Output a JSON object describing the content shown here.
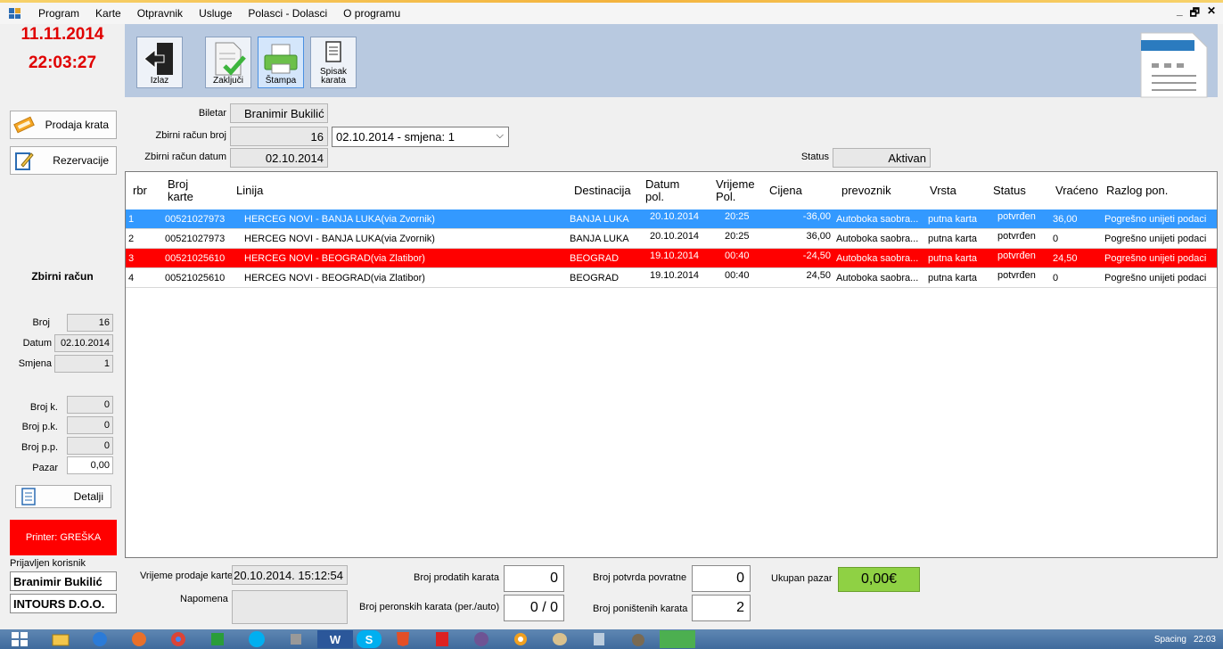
{
  "menu": {
    "items": [
      "Program",
      "Karte",
      "Otpravnik",
      "Usluge",
      "Polasci - Dolasci",
      "O programu"
    ],
    "win_min": "_",
    "win_restore": "🗗",
    "win_close": "✕"
  },
  "clock": {
    "date": "11.11.2014",
    "time": "22:03:27"
  },
  "sidebar": {
    "prodaja_label": "Prodaja krata",
    "rezervacije_label": "Rezervacije",
    "zbirni_title": "Zbirni račun",
    "broj_label": "Broj",
    "broj_value": "16",
    "datum_label": "Datum",
    "datum_value": "02.10.2014",
    "smjena_label": "Smjena",
    "smjena_value": "1",
    "brojk_label": "Broj k.",
    "brojk_value": "0",
    "brojpk_label": "Broj p.k.",
    "brojpk_value": "0",
    "brojpp_label": "Broj p.p.",
    "brojpp_value": "0",
    "pazar_label": "Pazar",
    "pazar_value": "0,00",
    "detalji_label": "Detalji",
    "printer_status": "Printer: GREŠKA",
    "prijavljen_label": "Prijavljen korisnik",
    "user_name": "Branimir Bukilić",
    "company": "INTOURS D.O.O."
  },
  "toolbar": {
    "izlaz": "Izlaz",
    "zakljuci": "Zaključi",
    "stampa": "Štampa",
    "spisak_1": "Spisak",
    "spisak_2": "karata"
  },
  "header": {
    "biletar_label": "Biletar",
    "biletar_value": "Branimir Bukilić",
    "racun_broj_label": "Zbirni račun broj",
    "racun_broj_value": "16",
    "smjena_select": "02.10.2014 - smjena: 1",
    "racun_datum_label": "Zbirni račun datum",
    "racun_datum_value": "02.10.2014",
    "status_label": "Status",
    "status_value": "Aktivan"
  },
  "grid": {
    "columns": {
      "rbr": "rbr",
      "broj_1": "Broj",
      "broj_2": "karte",
      "linija": "Linija",
      "destinacija": "Destinacija",
      "datum_1": "Datum",
      "datum_2": "pol.",
      "vrijeme_1": "Vrijeme",
      "vrijeme_2": "Pol.",
      "cijena": "Cijena",
      "prevoznik": "prevoznik",
      "vrsta": "Vrsta",
      "status": "Status",
      "vraceno": "Vraćeno",
      "razlog": "Razlog pon."
    },
    "rows": [
      {
        "rbr": "1",
        "broj": "00521027973",
        "linija": "HERCEG NOVI - BANJA LUKA(via Zvornik)",
        "dest": "BANJA LUKA",
        "datum": "20.10.2014",
        "vrijeme": "20:25",
        "cijena": "-36,00",
        "prevoznik": "Autoboka saobra...",
        "vrsta": "putna karta",
        "status": "potvrđen",
        "vraceno": "36,00",
        "razlog": "Pogrešno unijeti podaci"
      },
      {
        "rbr": "2",
        "broj": "00521027973",
        "linija": "HERCEG NOVI - BANJA LUKA(via Zvornik)",
        "dest": "BANJA LUKA",
        "datum": "20.10.2014",
        "vrijeme": "20:25",
        "cijena": "36,00",
        "prevoznik": "Autoboka saobra...",
        "vrsta": "putna karta",
        "status": "potvrđen",
        "vraceno": "0",
        "razlog": "Pogrešno unijeti podaci"
      },
      {
        "rbr": "3",
        "broj": "00521025610",
        "linija": "HERCEG NOVI - BEOGRAD(via Zlatibor)",
        "dest": "BEOGRAD",
        "datum": "19.10.2014",
        "vrijeme": "00:40",
        "cijena": "-24,50",
        "prevoznik": "Autoboka saobra...",
        "vrsta": "putna karta",
        "status": "potvrđen",
        "vraceno": "24,50",
        "razlog": "Pogrešno unijeti podaci"
      },
      {
        "rbr": "4",
        "broj": "00521025610",
        "linija": "HERCEG NOVI - BEOGRAD(via Zlatibor)",
        "dest": "BEOGRAD",
        "datum": "19.10.2014",
        "vrijeme": "00:40",
        "cijena": "24,50",
        "prevoznik": "Autoboka saobra...",
        "vrsta": "putna karta",
        "status": "potvrđen",
        "vraceno": "0",
        "razlog": "Pogrešno unijeti podaci"
      }
    ]
  },
  "bottom": {
    "vrijeme_label": "Vrijeme prodaje karte",
    "vrijeme_value": "20.10.2014. 15:12:54",
    "napomena_label": "Napomena",
    "prodatih_label": "Broj prodatih karata",
    "prodatih_value": "0",
    "peronskih_label": "Broj peronskih karata (per./auto)",
    "peronskih_value": "0 / 0",
    "potvrda_label": "Broj potvrda povratne",
    "potvrda_value": "0",
    "ponistenih_label": "Broj poništenih karata",
    "ponistenih_value": "2",
    "ukupan_label": "Ukupan pazar",
    "ukupan_value": "0,00€"
  },
  "taskbar": {
    "word_letter": "W",
    "skype_letter": "S",
    "spacing_label": "Spacing",
    "time": "22:03"
  },
  "colors": {
    "selected_row": "#3399ff",
    "cancelled_row": "#ff0000",
    "clock": "#e00000",
    "total_bg": "#8fd144"
  }
}
